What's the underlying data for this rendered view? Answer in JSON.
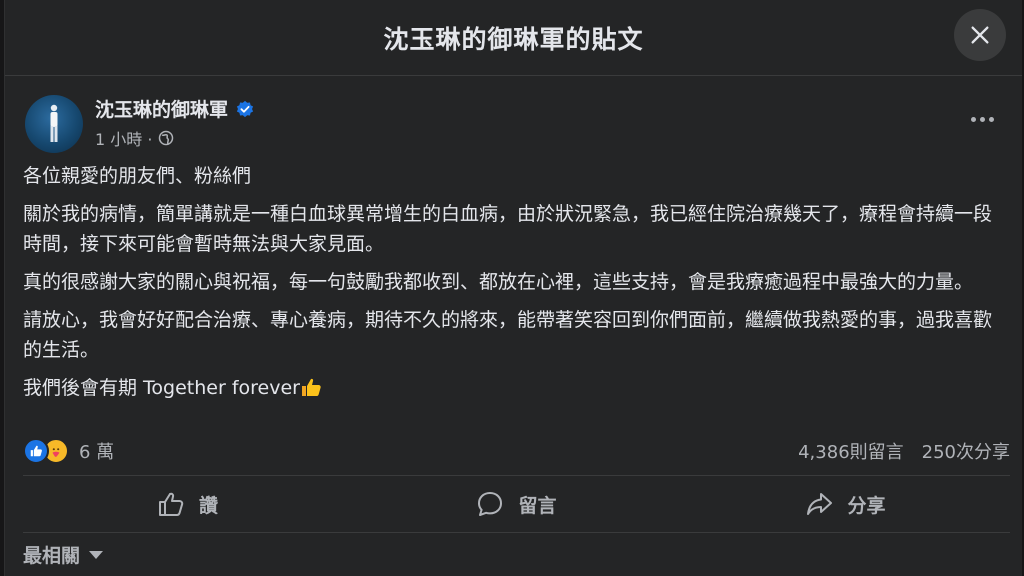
{
  "dialog": {
    "title": "沈玉琳的御琳軍的貼文"
  },
  "post": {
    "author": "沈玉琳的御琳軍",
    "time": "1 小時 ·",
    "paragraphs": [
      "各位親愛的朋友們、粉絲們",
      "關於我的病情，簡單講就是一種白血球異常增生的白血病，由於狀況緊急，我已經住院治療幾天了，療程會持續一段時間，接下來可能會暫時無法與大家見面。",
      "真的很感謝大家的關心與祝福，每一句鼓勵我都收到、都放在心裡，這些支持，會是我療癒過程中最強大的力量。",
      "請放心，我會好好配合治療、專心養病，期待不久的將來，能帶著笑容回到你們面前，繼續做我熱愛的事，過我喜歡的生活。"
    ],
    "closing": "我們後會有期  Together forever"
  },
  "stats": {
    "reactions": "6 萬",
    "comments": "4,386則留言",
    "shares": "250次分享"
  },
  "actions": {
    "like": "讚",
    "comment": "留言",
    "share": "分享"
  },
  "sort": {
    "label": "最相關"
  },
  "icons": {
    "close": "close-icon",
    "verified": "verified-badge-icon",
    "globe": "globe-icon",
    "more": "more-icon",
    "like": "like-icon",
    "comment": "comment-icon",
    "share": "share-icon",
    "dropdown": "chevron-down-icon"
  },
  "colors": {
    "background": "#242526",
    "text": "#e4e6eb",
    "secondary": "#b0b3b8",
    "accent": "#1b74e4"
  }
}
